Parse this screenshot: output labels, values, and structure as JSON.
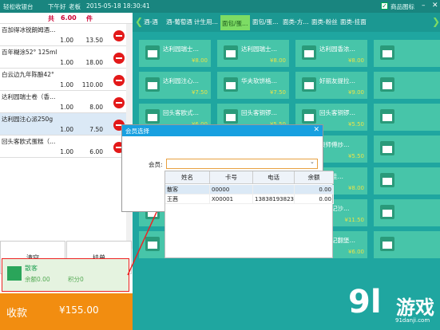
{
  "titlebar": {
    "app_name": "轻松收银台",
    "shift": "下午好",
    "user": "老板",
    "datetime": "2015-05-18 18:30:41",
    "checkbox_label": "商品图标",
    "min": "–",
    "close": "✕"
  },
  "cart": {
    "count_label": "共",
    "count_value": "6.00",
    "count_unit": "件",
    "items": [
      {
        "name": "百加得冰锐朗姆酒…",
        "qty": "1.00",
        "price": "13.50"
      },
      {
        "name": "百年糊涂52° 125ml",
        "qty": "1.00",
        "price": "18.00"
      },
      {
        "name": "白云边九年陈酿42°",
        "qty": "1.00",
        "price": "110.00"
      },
      {
        "name": "达利园瑞士卷（香…",
        "qty": "1.00",
        "price": "8.00"
      },
      {
        "name": "达利园注心派250g",
        "qty": "1.00",
        "price": "7.50"
      },
      {
        "name": "回头客欧式蛋糕（…",
        "qty": "1.00",
        "price": "6.00"
      }
    ]
  },
  "buttons": {
    "clear": "清空",
    "hold": "挂单"
  },
  "member": {
    "name": "散客",
    "balance": "余额0.00",
    "points": "积分0"
  },
  "checkout": {
    "label": "收款",
    "amount": "¥155.00"
  },
  "tabs": [
    "酒-酒",
    "酒-葡萄酒",
    "计生用…",
    "面包/蛋…",
    "面包/蛋…",
    "面类-方…",
    "面类-粉丝",
    "面类-挂面"
  ],
  "products": [
    {
      "name": "达利园瑞士…",
      "price": "¥8.00"
    },
    {
      "name": "达利园瑞士…",
      "price": "¥8.00"
    },
    {
      "name": "达利园香浓…",
      "price": "¥8.00"
    },
    {
      "name": "",
      "price": ""
    },
    {
      "name": "达利园注心…",
      "price": "¥7.50"
    },
    {
      "name": "华夫软饼格…",
      "price": "¥7.50"
    },
    {
      "name": "好丽友提拉…",
      "price": "¥9.00"
    },
    {
      "name": "",
      "price": ""
    },
    {
      "name": "回头客欧式…",
      "price": "¥6.00"
    },
    {
      "name": "回头客铜锣…",
      "price": "¥5.50"
    },
    {
      "name": "回头客铜锣…",
      "price": "¥5.50"
    },
    {
      "name": "",
      "price": ""
    },
    {
      "name": "",
      "price": ""
    },
    {
      "name": "",
      "price": ""
    },
    {
      "name": "康师傅炒…",
      "price": "¥5.50"
    },
    {
      "name": "",
      "price": ""
    },
    {
      "name": "",
      "price": ""
    },
    {
      "name": "瑞士…",
      "price": "¥8.00"
    },
    {
      "name": "曦达佳…",
      "price": "¥8.00"
    },
    {
      "name": "",
      "price": ""
    },
    {
      "name": "",
      "price": ""
    },
    {
      "name": "",
      "price": "¥11.50"
    },
    {
      "name": "徐福记沙…",
      "price": "¥11.50"
    },
    {
      "name": "",
      "price": ""
    },
    {
      "name": "",
      "price": ""
    },
    {
      "name": "回头客欧式…",
      "price": "¥6.00"
    },
    {
      "name": "徐福记翻堡…",
      "price": "¥6.00"
    },
    {
      "name": "",
      "price": ""
    }
  ],
  "dialog": {
    "title": "会员选择",
    "close": "✕",
    "member_label": "会员:",
    "member_value": "",
    "columns": [
      "姓名",
      "卡号",
      "电话",
      "余额"
    ],
    "rows": [
      {
        "name": "散客",
        "card": "00000",
        "phone": "",
        "balance": "0.00"
      },
      {
        "name": "王茜",
        "card": "X00001",
        "phone": "13838193823",
        "balance": "0.00"
      }
    ]
  },
  "watermark": {
    "num": "9l",
    "text": "游戏",
    "site": "91danji.com"
  }
}
